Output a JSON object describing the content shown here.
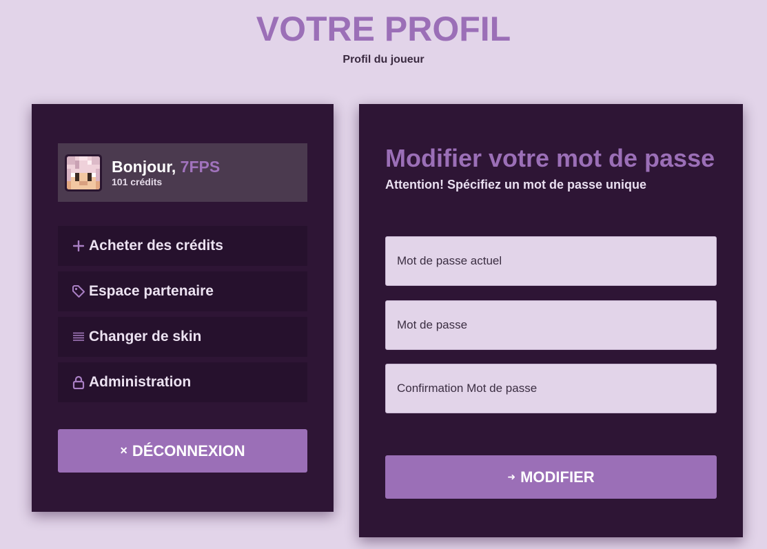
{
  "header": {
    "title": "VOTRE PROFIL",
    "subtitle": "Profil du joueur"
  },
  "user": {
    "greeting": "Bonjour,",
    "username": "7FPS",
    "credits": "101 crédits",
    "avatar_icon": "player-skin-head-icon"
  },
  "sidebar": {
    "items": [
      {
        "label": "Acheter des crédits",
        "icon": "plus-icon"
      },
      {
        "label": "Espace partenaire",
        "icon": "tag-icon"
      },
      {
        "label": "Changer de skin",
        "icon": "list-icon"
      },
      {
        "label": "Administration",
        "icon": "lock-icon"
      }
    ],
    "logout": {
      "glyph": "×",
      "label": "DÉCONNEXION"
    }
  },
  "password_form": {
    "title": "Modifier votre mot de passe",
    "subtitle": "Attention! Spécifiez un mot de passe unique",
    "fields": [
      {
        "placeholder": "Mot de passe actuel"
      },
      {
        "placeholder": "Mot de passe"
      },
      {
        "placeholder": "Confirmation Mot de passe"
      }
    ],
    "submit": {
      "glyph": "➜",
      "label": "MODIFIER"
    }
  },
  "colors": {
    "background": "#e2d4e9",
    "panel": "#2e1535",
    "accent": "#9b6fb7",
    "menu_item": "#26112d",
    "user_card": "#4b3a4f"
  }
}
